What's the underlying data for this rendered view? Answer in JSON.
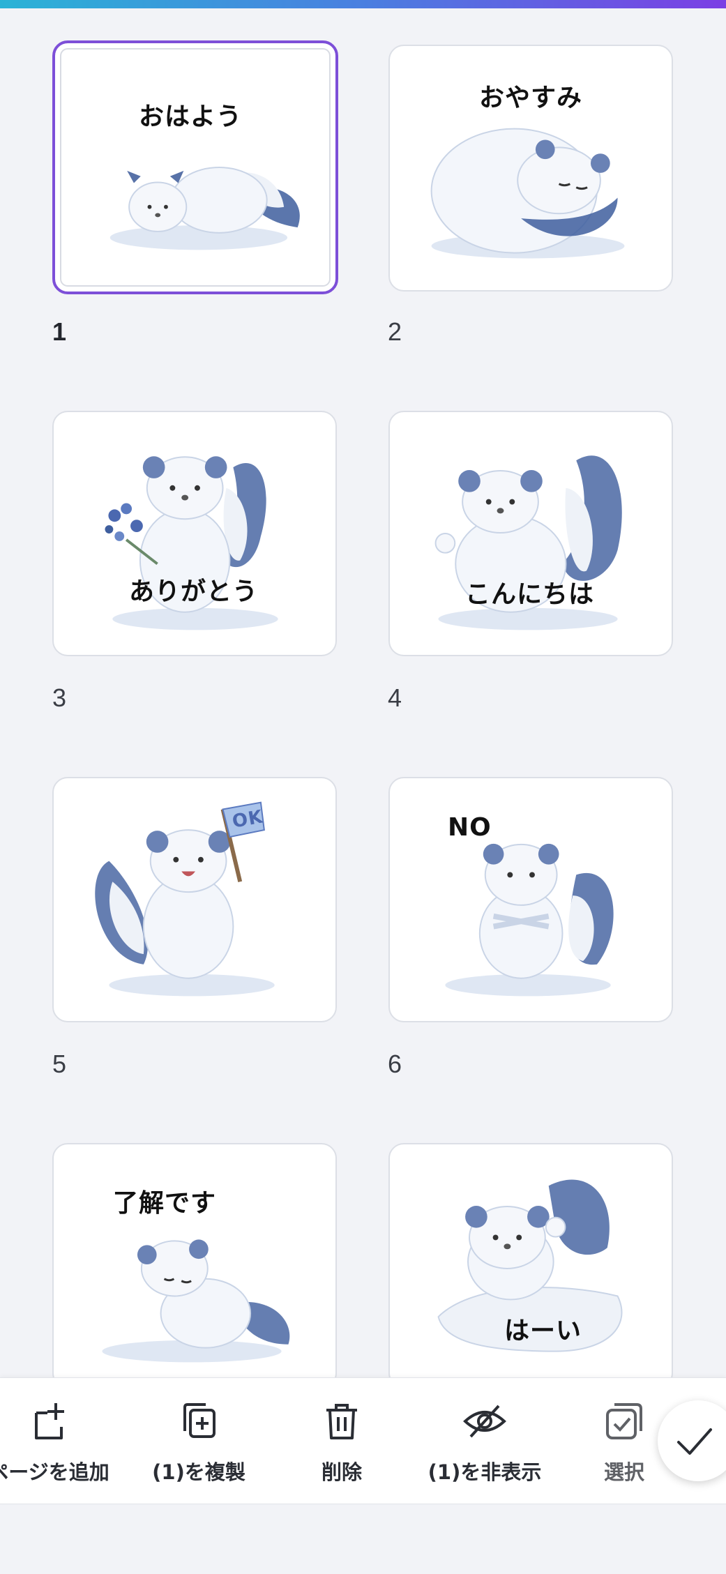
{
  "pages": [
    {
      "number": "1",
      "caption": "おはよう",
      "selected": true
    },
    {
      "number": "2",
      "caption": "おやすみ",
      "selected": false
    },
    {
      "number": "3",
      "caption": "ありがとう",
      "selected": false
    },
    {
      "number": "4",
      "caption": "こんにちは",
      "selected": false
    },
    {
      "number": "5",
      "caption": "",
      "flag_text": "OK",
      "selected": false
    },
    {
      "number": "6",
      "caption": "NO",
      "selected": false
    },
    {
      "number": "",
      "caption": "了解です",
      "selected": false
    },
    {
      "number": "",
      "caption": "はーい",
      "selected": false
    }
  ],
  "toolbar": {
    "add_page": "ページを追加",
    "duplicate": "(1)を複製",
    "delete": "削除",
    "hide": "(1)を非表示",
    "select": "選択"
  },
  "icons": {
    "add_page": "add-page-icon",
    "duplicate": "duplicate-icon",
    "delete": "trash-icon",
    "hide": "eye-off-icon",
    "select": "select-multiple-icon",
    "done": "check-icon"
  },
  "colors": {
    "accent": "#7d4fd8",
    "background": "#f2f3f7",
    "gradient_start": "#2bb3d6",
    "gradient_end": "#7b3fe4"
  }
}
